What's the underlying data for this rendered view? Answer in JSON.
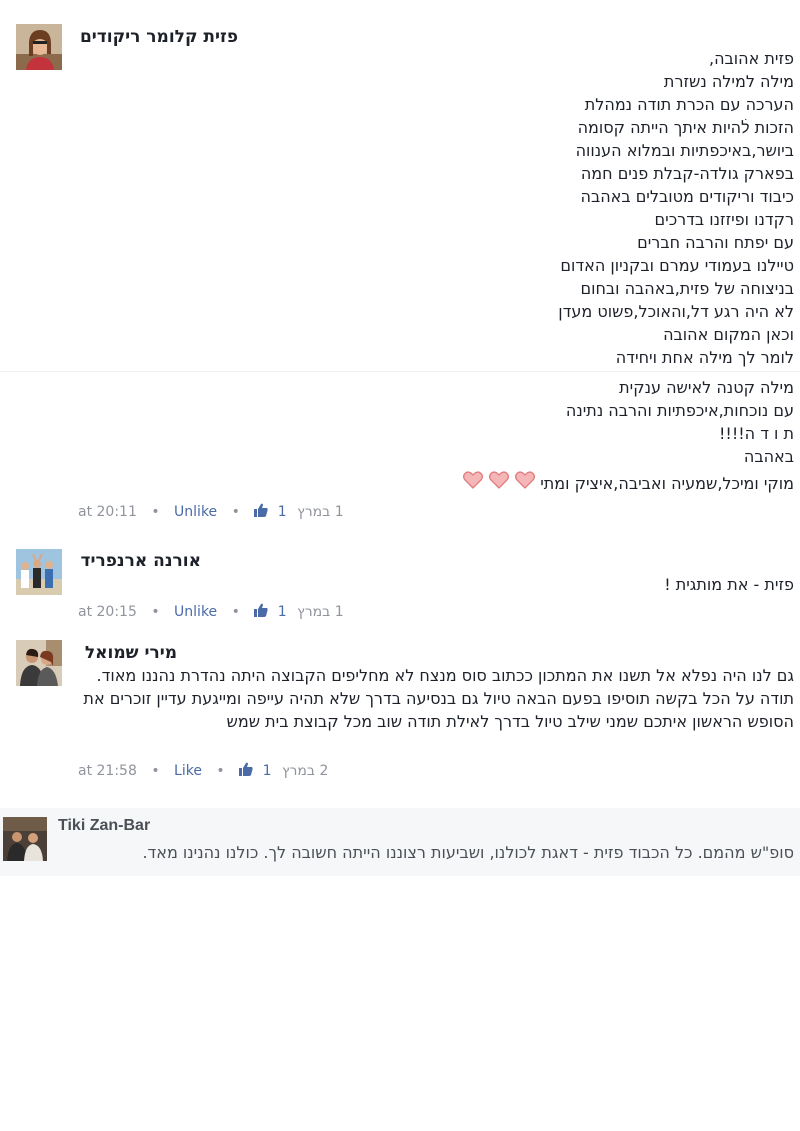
{
  "comments": [
    {
      "author": "פזית קלומר ריקודים",
      "avatar_icon": "profile-photo-woman-icon",
      "lines": [
        "פזית אהובה,",
        "מילה למילה נשזרת",
        "הערכה עם הכרת תודה נמהלת",
        "הזכות לׄהיות איתך הייתה קסומה",
        "ביושר,באיכפתיות ובמלוא הענווה",
        "בפארק גולדה-קבלת פנים חמה",
        "כיבוד וריקודים מטובלים באהבה",
        "רקדנו ופיזזנו בדרכים",
        "עם יפתח והרבה חברים",
        "טיילנו בעמודי עמרם ובקניון האדום",
        "בניצוחה של פזית,באהבה ובחום",
        "לא היה רגע דל,והאוכל,פשוט מעדן",
        "וכאן המקום אהובה",
        "לומר לך מילה אחת ויחידה"
      ],
      "lines2": [
        "מילה קטנה לאישה ענקית",
        "עם נוכחות,איכפתיות והרבה נתינה",
        "ת ו ד ה!!!!",
        "באהבה"
      ],
      "signature": "מוקי ומיכל,שמעיה ואביבה,איציק ומתי",
      "time": "at 20:11",
      "action": "Unlike",
      "likes": "1",
      "date": "1 במרץ"
    },
    {
      "author": "אורנה ארנפריד",
      "avatar_icon": "profile-photo-group-icon",
      "text": "פזית - את מותגית !",
      "time": "at 20:15",
      "action": "Unlike",
      "likes": "1",
      "date": "1 במרץ"
    },
    {
      "author": "מירי שמואל",
      "avatar_icon": "profile-photo-couple-icon",
      "text": "גם לנו היה נפלא אל תשנו את המתכון ככתוב סוס מנצח לא מחליפים הקבוצה היתה נהדרת נהננו מאוד. תודה על הכל בקשה תוסיפו בפעם הבאה טיול גם בנסיעה בדרך שלא תהיה עייפה ומייגעת עדיין זוכרים את הסופש הראשון איתכם שמני שילב טיול בדרך לאילת תודה שוב מכל קבוצת בית שמש",
      "time": "at 21:58",
      "action": "Like",
      "likes": "1",
      "date": "2 במרץ"
    }
  ],
  "reply": {
    "author": "Tiki Zan-Bar",
    "avatar_icon": "profile-photo-couple-icon",
    "text": "סופ\"ש מהמם. כל הכבוד פזית - דאגת לכולנו, ושביעות רצוננו הייתה חשובה לך. כולנו נהנינו מאד."
  },
  "colors": {
    "link": "#4b6ba8",
    "meta": "#90949c",
    "heart_fill": "#f4b6b6",
    "heart_stroke": "#e07c7c",
    "reply_bg": "#f6f7f9"
  }
}
